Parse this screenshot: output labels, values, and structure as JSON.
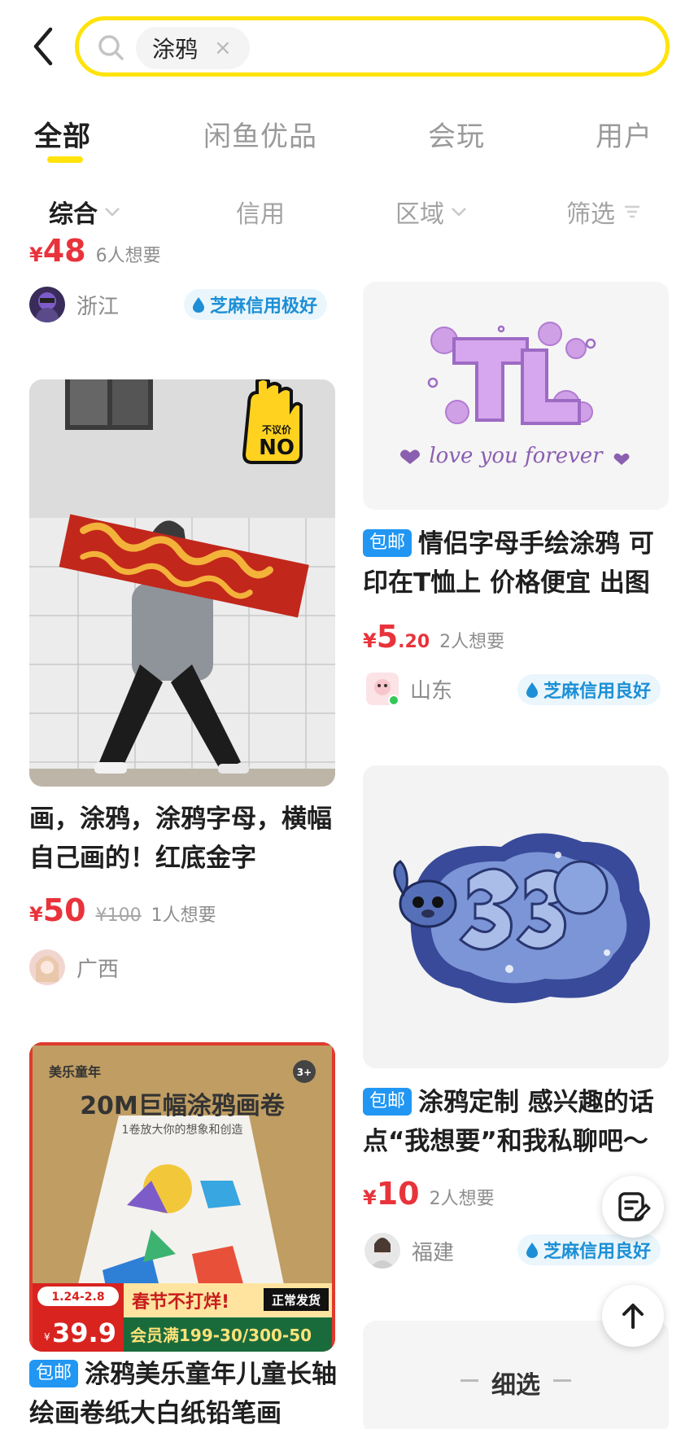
{
  "search": {
    "query": "涂鸦",
    "clear": "×"
  },
  "tabs": [
    {
      "label": "全部"
    },
    {
      "label": "闲鱼优品"
    },
    {
      "label": "会玩"
    },
    {
      "label": "用户"
    }
  ],
  "filters": [
    {
      "label": "综合"
    },
    {
      "label": "信用"
    },
    {
      "label": "区域"
    },
    {
      "label": "筛选"
    }
  ],
  "items": [
    {
      "price_symbol": "¥",
      "price_int": "48",
      "want": "6人想要",
      "location": "浙江",
      "credit": "芝麻信用极好"
    },
    {
      "image_text": "不议价 NO",
      "title": "画，涂鸦，涂鸦字母，横幅 自己画的！红底金字",
      "price_symbol": "¥",
      "price_int": "50",
      "original_price": "¥100",
      "want": "1人想要",
      "location": "广西"
    },
    {
      "image_text": {
        "brand": "美乐童年",
        "age": "3+",
        "headline": "20M巨幅涂鸦画卷",
        "sub": "1卷放大你的想象和创造",
        "dates": "1.24-2.8",
        "price": "39.9",
        "promo": "春节不打烊!",
        "ship": "正常发货",
        "member": "会员满199-30/300-50"
      },
      "tag": "包邮",
      "title": "涂鸦美乐童年儿童长轴绘画卷纸大白纸铅笔画"
    },
    {
      "image_text": "love you forever",
      "tag": "包邮",
      "title": "情侣字母手绘涂鸦 可印在T恤上 价格便宜 出图",
      "price_symbol": "¥",
      "price_int": "5",
      "price_dec": ".20",
      "want": "2人想要",
      "location": "山东",
      "credit": "芝麻信用良好"
    },
    {
      "tag": "包邮",
      "title": "涂鸦定制 感兴趣的话点“我想要”和我私聊吧～",
      "price_symbol": "¥",
      "price_int": "10",
      "want": "2人想要",
      "location": "福建",
      "credit": "芝麻信用良好"
    }
  ],
  "refine": {
    "label": "细选"
  },
  "colors": {
    "accent": "#ffe30a",
    "price": "#e8333b",
    "tag": "#2196f3",
    "credit": "#1c8fd6"
  }
}
